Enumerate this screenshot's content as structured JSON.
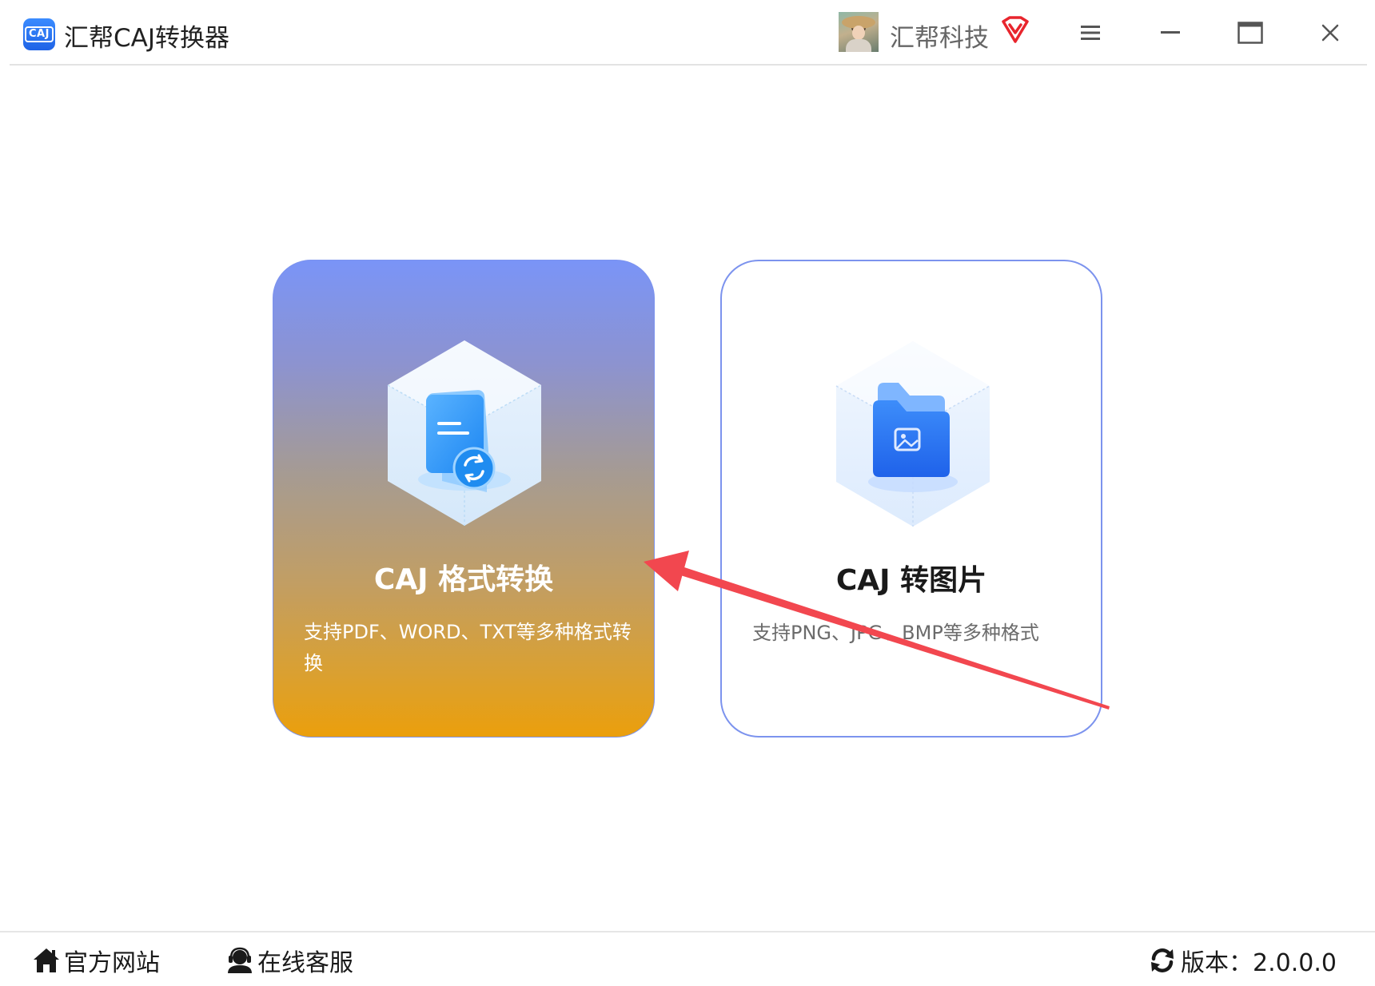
{
  "app": {
    "logo_text": "CAJ",
    "title": "汇帮CAJ转换器"
  },
  "user": {
    "name": "汇帮科技"
  },
  "window_controls": {
    "menu": "menu-icon",
    "minimize": "minimize-icon",
    "maximize": "maximize-icon",
    "close": "close-icon"
  },
  "cards": [
    {
      "title": "CAJ 格式转换",
      "description": "支持PDF、WORD、TXT等多种格式转换",
      "icon": "document-convert-icon"
    },
    {
      "title": "CAJ 转图片",
      "description": "支持PNG、JPG、BMP等多种格式",
      "icon": "image-folder-icon"
    }
  ],
  "footer": {
    "website": "官方网站",
    "support": "在线客服",
    "version": "版本：2.0.0.0"
  },
  "colors": {
    "accent_blue": "#7c93ee",
    "card_gradient_top": "#7a94f7",
    "card_gradient_bottom": "#eb9f0c",
    "annotation_arrow": "#f2474f",
    "vip_red": "#e8252d"
  }
}
